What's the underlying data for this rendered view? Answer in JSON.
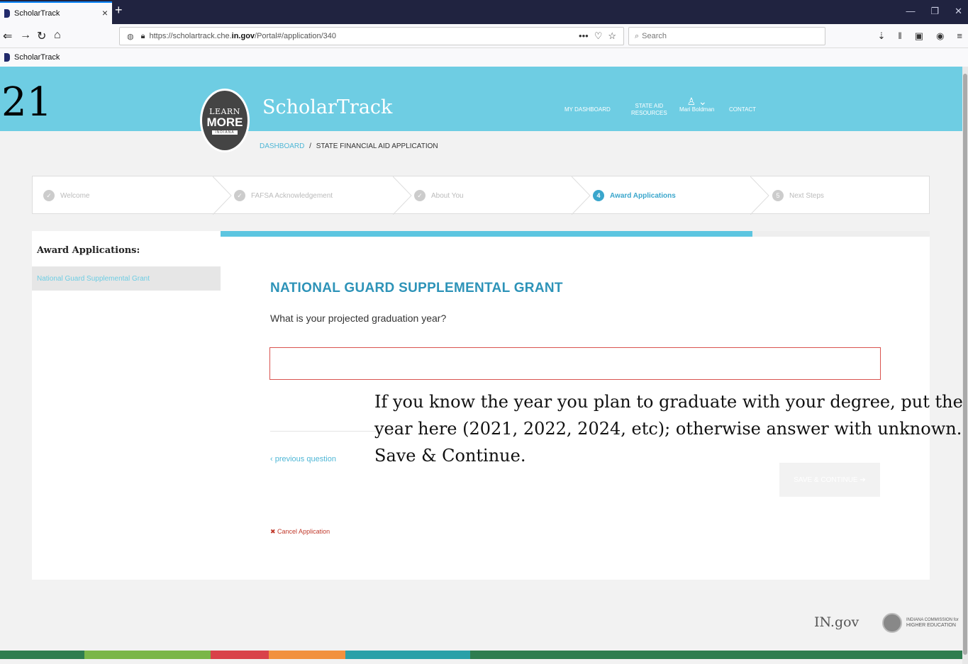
{
  "browser": {
    "tab_title": "ScholarTrack",
    "tab_close": "×",
    "new_tab": "+",
    "url_prefix": "https://scholartrack.che.",
    "url_domain": "in.gov",
    "url_path": "/Portal#/application/340",
    "search_placeholder": "Search",
    "bookmark": "ScholarTrack"
  },
  "page_number": "21",
  "header": {
    "logo_line1": "LEARN",
    "logo_line2": "MORE",
    "logo_line3": "INDIANA",
    "site_title": "ScholarTrack",
    "nav": {
      "dashboard": "MY DASHBOARD",
      "state_aid_1": "STATE AID",
      "state_aid_2": "RESOURCES",
      "user": "Mari Boldman",
      "contact": "CONTACT"
    }
  },
  "breadcrumb": {
    "link": "DASHBOARD",
    "separator": "/",
    "current": "STATE FINANCIAL AID APPLICATION"
  },
  "stepper": {
    "steps": [
      {
        "number": "✓",
        "label": "Welcome"
      },
      {
        "number": "✓",
        "label": "FAFSA Acknowledgement"
      },
      {
        "number": "✓",
        "label": "About You"
      },
      {
        "number": "4",
        "label": "Award Applications"
      },
      {
        "number": "5",
        "label": "Next Steps"
      }
    ]
  },
  "sidebar": {
    "title": "Award Applications:",
    "items": [
      {
        "label": "National Guard Supplemental Grant"
      }
    ]
  },
  "main": {
    "progress_fraction": 0.75,
    "question_title": "NATIONAL GUARD SUPPLEMENTAL GRANT",
    "question_text": "What is your projected graduation year?",
    "answer_value": "",
    "previous_label": "‹ previous question",
    "save_label": "SAVE & CONTINUE ➔",
    "cancel_label": "✖ Cancel Application"
  },
  "annotation": "If you know the year you plan to graduate with your degree, put the year here (2021, 2022, 2024, etc); otherwise answer with unknown. Save & Continue.",
  "footer": {
    "gov_logo": "IN.gov",
    "commission_line1": "INDIANA COMMISSION for",
    "commission_line2": "HIGHER EDUCATION"
  },
  "colors": {
    "header": "#6ecde3",
    "accent": "#2d93b8",
    "error": "#d9534f",
    "colorbar": [
      "#2e7d4f",
      "#7ab648",
      "#d9424a",
      "#f2913d",
      "#2aa0a8",
      "#2e7d4f"
    ]
  }
}
